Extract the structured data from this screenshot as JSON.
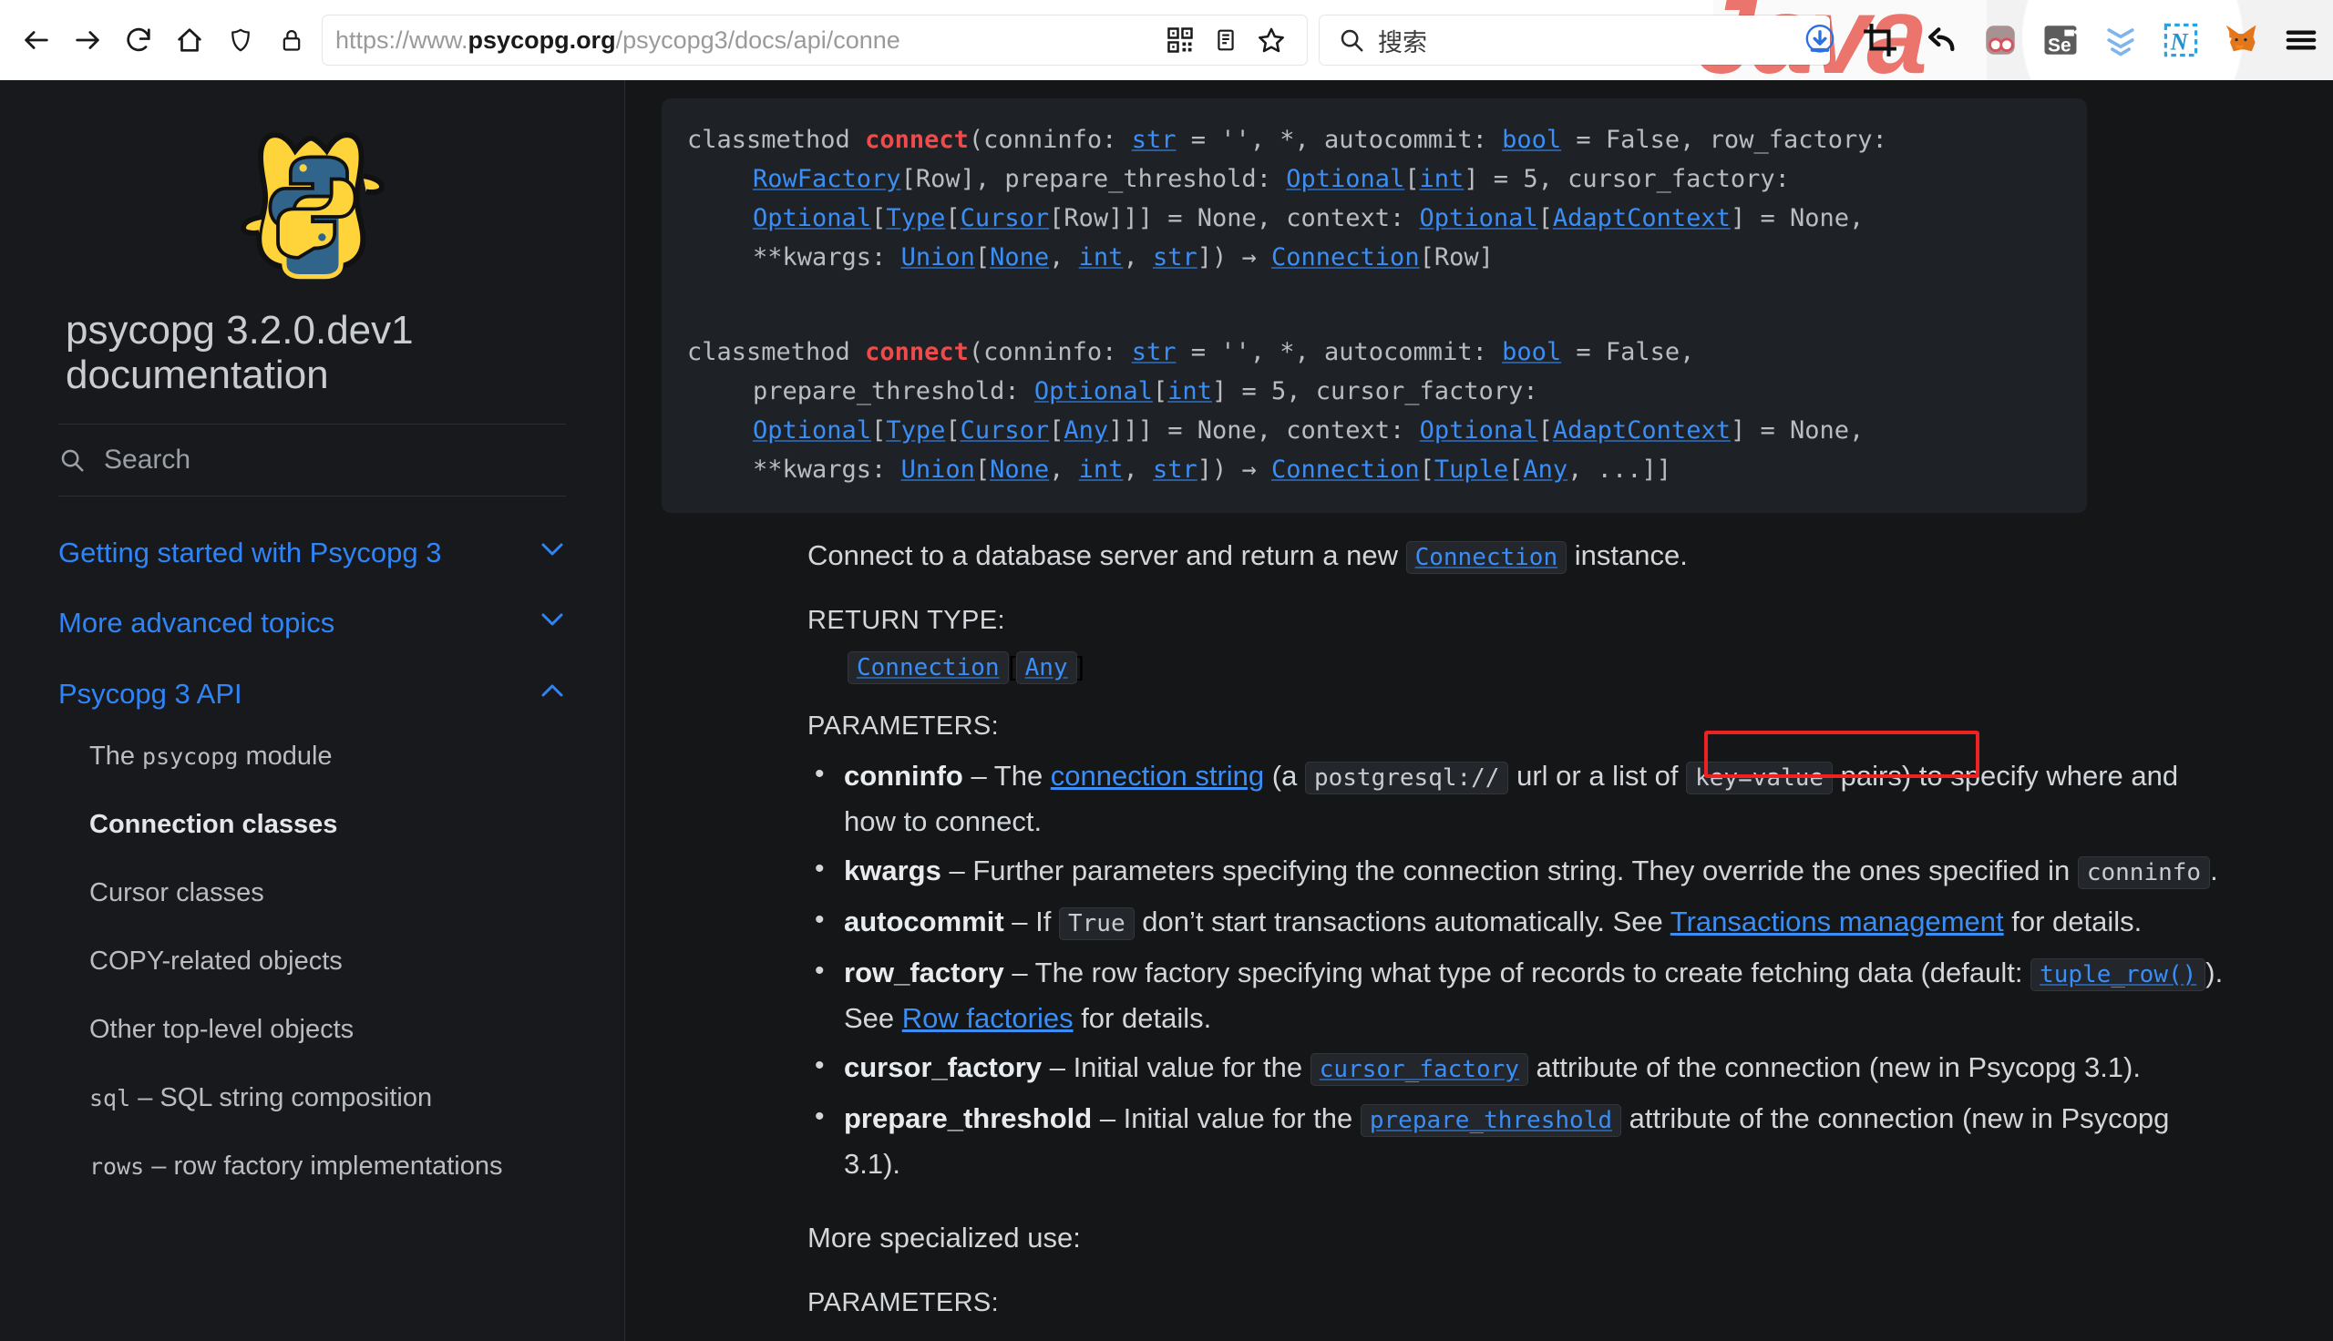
{
  "browser": {
    "back_tooltip": "Back",
    "forward_tooltip": "Forward",
    "reload_tooltip": "Reload",
    "home_tooltip": "Home",
    "shield_tooltip": "Tracking protection",
    "lock_tooltip": "Connection secure",
    "url_prefix": "https://www.",
    "url_domain": "psycopg.org",
    "url_path": "/psycopg3/docs/api/conne",
    "url_full": "https://www.psycopg.org/psycopg3/docs/api/conne",
    "qr_tooltip": "QR code",
    "reader_tooltip": "Reader view",
    "bookmark_tooltip": "Bookmark this page",
    "search_placeholder": "搜索",
    "extensions": [
      {
        "name": "download-icon",
        "label": "Download"
      },
      {
        "name": "crop-screenshot-icon",
        "label": "Crop"
      },
      {
        "name": "undo-arrow-icon",
        "label": "Undo"
      },
      {
        "name": "two-circles-icon",
        "label": "Glasses"
      },
      {
        "name": "selenium-ide-icon",
        "label": "Se"
      },
      {
        "name": "blue-chevrons-icon",
        "label": "Chevrons"
      },
      {
        "name": "nimbus-capture-icon",
        "label": "N"
      },
      {
        "name": "metamask-fox-icon",
        "label": "MetaMask"
      },
      {
        "name": "app-menu-icon",
        "label": "Menu"
      }
    ]
  },
  "sidebar": {
    "logo_alt": "psycopg elephant and python logo",
    "title": "psycopg 3.2.0.dev1 documentation",
    "search_placeholder": "Search",
    "groups": [
      {
        "label": "Getting started with Psycopg 3",
        "expanded": false,
        "chevron": "chevron-down-icon"
      },
      {
        "label": "More advanced topics",
        "expanded": false,
        "chevron": "chevron-down-icon"
      },
      {
        "label": "Psycopg 3 API",
        "expanded": true,
        "chevron": "chevron-up-icon"
      }
    ],
    "sub_items": [
      {
        "prefix": "The ",
        "code": "psycopg",
        "suffix": " module",
        "current": false
      },
      {
        "prefix": "Connection classes",
        "code": "",
        "suffix": "",
        "current": true
      },
      {
        "prefix": "Cursor classes",
        "code": "",
        "suffix": "",
        "current": false
      },
      {
        "prefix": "COPY-related objects",
        "code": "",
        "suffix": "",
        "current": false
      },
      {
        "prefix": "Other top-level objects",
        "code": "",
        "suffix": "",
        "current": false
      },
      {
        "prefix": "",
        "code": "sql",
        "suffix": " – SQL string composition",
        "current": false
      },
      {
        "prefix": "",
        "code": "rows",
        "suffix": " – row factory implementations",
        "current": false
      }
    ]
  },
  "content": {
    "signature1": {
      "l1_kw": "classmethod ",
      "l1_fn": "connect",
      "l1_a": "(conninfo: ",
      "l1_t1": "str",
      "l1_b": " = '', *, autocommit: ",
      "l1_t2": "bool",
      "l1_c": " = False, row_factory:",
      "l2_t1": "RowFactory",
      "l2_a": "[Row], prepare_threshold: ",
      "l2_t2": "Optional",
      "l2_b": "[",
      "l2_t3": "int",
      "l2_c": "] = 5, cursor_factory:",
      "l3_t1": "Optional",
      "l3_a": "[",
      "l3_t2": "Type",
      "l3_b": "[",
      "l3_t3": "Cursor",
      "l3_c": "[Row]]] = None, context: ",
      "l3_t4": "Optional",
      "l3_d": "[",
      "l3_t5": "AdaptContext",
      "l3_e": "] = None,",
      "l4_a": "**kwargs: ",
      "l4_t1": "Union",
      "l4_b": "[",
      "l4_t2": "None",
      "l4_c": ", ",
      "l4_t3": "int",
      "l4_d": ", ",
      "l4_t4": "str",
      "l4_e": "]) → ",
      "l4_t5": "Connection",
      "l4_f": "[Row]"
    },
    "signature2": {
      "l1_kw": "classmethod ",
      "l1_fn": "connect",
      "l1_a": "(conninfo: ",
      "l1_t1": "str",
      "l1_b": " = '', *, autocommit: ",
      "l1_t2": "bool",
      "l1_c": " = False,",
      "l2_a": "prepare_threshold: ",
      "l2_t1": "Optional",
      "l2_b": "[",
      "l2_t2": "int",
      "l2_c": "] = 5, cursor_factory:",
      "l3_t1": "Optional",
      "l3_a": "[",
      "l3_t2": "Type",
      "l3_b": "[",
      "l3_t3": "Cursor",
      "l3_c": "[",
      "l3_t4": "Any",
      "l3_c2": "]]] = None, context: ",
      "l3_t5": "Optional",
      "l3_d": "[",
      "l3_t6": "AdaptContext",
      "l3_e": "] = None,",
      "l4_a": "**kwargs: ",
      "l4_t1": "Union",
      "l4_b": "[",
      "l4_t2": "None",
      "l4_c": ", ",
      "l4_t3": "int",
      "l4_d": ", ",
      "l4_t4": "str",
      "l4_e": "]) → ",
      "l4_t5": "Connection",
      "l4_f": "[",
      "l4_t6": "Tuple",
      "l4_g": "[",
      "l4_t7": "Any",
      "l4_h": ", ...]]"
    },
    "intro_a": "Connect to a database server and return a new ",
    "intro_code": "Connection",
    "intro_b": " instance.",
    "return_type_label": "RETURN TYPE:",
    "return_type_code1": "Connection",
    "return_type_bracket_open": "[",
    "return_type_code2": "Any",
    "return_type_bracket_close": "]",
    "parameters_label": "PARAMETERS:",
    "params": [
      {
        "name": "conninfo",
        "dash": " – ",
        "t1": "The ",
        "link": "connection string",
        "t2": " (a ",
        "code1": "postgresql://",
        "t3": " url or a list of ",
        "code2": "key=value",
        "t4": " pairs) to specify where and how to connect.",
        "highlighted": true
      },
      {
        "name": "kwargs",
        "dash": " – ",
        "t1": "Further parameters specifying the connection string. They override the ones specified in ",
        "code1": "conninfo",
        "t2": ".",
        "highlighted": false
      },
      {
        "name": "autocommit",
        "dash": " – ",
        "t1": "If ",
        "code1": "True",
        "t2": " don’t start transactions automatically. See ",
        "link": "Transactions management",
        "t3": " for details.",
        "highlighted": false
      },
      {
        "name": "row_factory",
        "dash": " – ",
        "t1": "The row factory specifying what type of records to create fetching data (default: ",
        "code1": "tuple_row()",
        "t2": "). See ",
        "link": "Row factories",
        "t3": " for details.",
        "highlighted": false
      },
      {
        "name": "cursor_factory",
        "dash": " – ",
        "t1": "Initial value for the ",
        "code1": "cursor_factory",
        "t2": " attribute of the connection (new in Psycopg 3.1).",
        "highlighted": false
      },
      {
        "name": "prepare_threshold",
        "dash": " – ",
        "t1": "Initial value for the ",
        "code1": "prepare_threshold",
        "t2": " attribute of the connection (new in Psycopg 3.1).",
        "highlighted": false
      }
    ],
    "more_specialized": "More specialized use:",
    "parameters_label2": "PARAMETERS:"
  },
  "annotation": {
    "target": "connection string",
    "color": "#ee2222",
    "shape": "rectangle"
  },
  "colors": {
    "page_bg": "#141618",
    "sidebar_bg": "#17191c",
    "code_bg": "#1e2125",
    "link_blue": "#3a8ef6",
    "nav_blue": "#2f85f7",
    "fn_red": "#ef4b4b",
    "text": "#d3d7da",
    "annotation_red": "#ee2222"
  }
}
